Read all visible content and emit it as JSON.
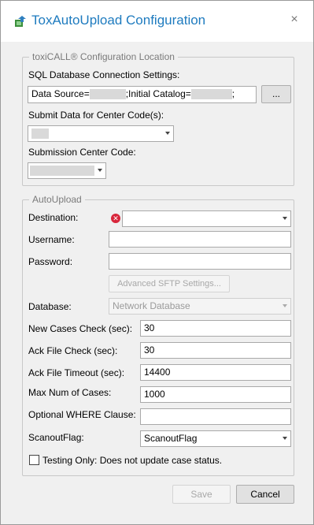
{
  "window": {
    "title": "ToxAutoUpload Configuration",
    "close_glyph": "×"
  },
  "config_location": {
    "legend": "toxiCALL® Configuration Location",
    "sql_label": "SQL Database Connection Settings:",
    "conn_part1": "Data Source=",
    "conn_part2": ";Initial Catalog=",
    "conn_part3": ";",
    "browse_label": "...",
    "submit_label": "Submit Data for Center Code(s):",
    "submission_label": "Submission Center Code:"
  },
  "autoupload": {
    "legend": "AutoUpload",
    "destination_label": "Destination:",
    "username_label": "Username:",
    "password_label": "Password:",
    "advanced_sftp_label": "Advanced SFTP Settings...",
    "database_label": "Database:",
    "database_value": "Network Database",
    "new_cases_label": "New Cases Check (sec):",
    "new_cases_value": "30",
    "ack_check_label": "Ack File Check (sec):",
    "ack_check_value": "30",
    "ack_timeout_label": "Ack File Timeout (sec):",
    "ack_timeout_value": "14400",
    "max_cases_label": "Max Num of Cases:",
    "max_cases_value": "1000",
    "where_label": "Optional WHERE Clause:",
    "where_value": "",
    "scanout_label": "ScanoutFlag:",
    "scanout_value": "ScanoutFlag",
    "testing_label": "Testing Only: Does not update case status.",
    "testing_checked": false
  },
  "footer": {
    "save_label": "Save",
    "cancel_label": "Cancel"
  },
  "icons": {
    "app": "app-upload-icon",
    "error": "error-icon",
    "close": "close-icon",
    "dropdown": "chevron-down-icon"
  },
  "colors": {
    "title": "#1e7bbf",
    "error": "#d8263b"
  }
}
